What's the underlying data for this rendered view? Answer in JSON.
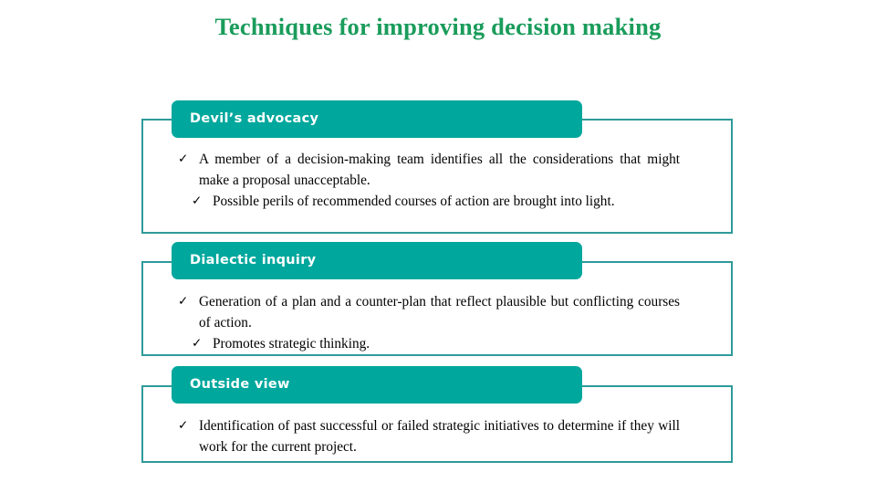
{
  "slide": {
    "title": "Techniques for improving decision making",
    "title_color": "#1a9c5b",
    "background_color": "#ffffff"
  },
  "theme": {
    "header_fill": "#00a79d",
    "frame_border": "#2f9a9a",
    "header_text_color": "#ffffff",
    "body_text_color": "#000000",
    "bullet_glyph": "✓",
    "bullet_icon_name": "check-mark-icon"
  },
  "sections": [
    {
      "id": "devils-advocacy",
      "header": "Devil’s advocacy",
      "bullets": [
        {
          "text": "A member of a decision-making team identifies all the considerations that might make a proposal unacceptable.",
          "indent": false,
          "justify": true
        },
        {
          "text": "Possible perils of recommended courses of action are brought into light.",
          "indent": true,
          "justify": false
        }
      ]
    },
    {
      "id": "dialectic-inquiry",
      "header": "Dialectic inquiry",
      "bullets": [
        {
          "text": "Generation of a plan and a counter-plan that reflect plausible but conflicting courses of action.",
          "indent": false,
          "justify": true
        },
        {
          "text": "Promotes strategic thinking.",
          "indent": true,
          "justify": false
        }
      ]
    },
    {
      "id": "outside-view",
      "header": "Outside view",
      "bullets": [
        {
          "text": "Identification of past successful or failed strategic initiatives to determine if they will work for the current project.",
          "indent": false,
          "justify": true
        }
      ]
    }
  ]
}
